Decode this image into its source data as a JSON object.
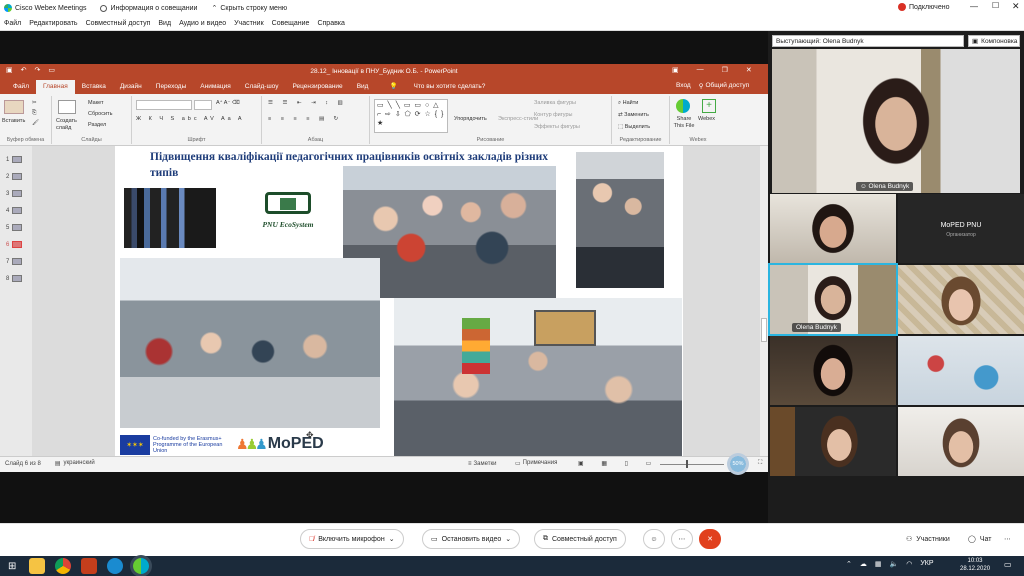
{
  "titlebar": {
    "app": "Cisco Webex Meetings",
    "tabs": [
      "Информация о совещании",
      "Скрыть строку меню"
    ],
    "connection": "Подключено",
    "colors": {
      "connected": "#d93025"
    }
  },
  "menubar": [
    "Файл",
    "Редактировать",
    "Совместный доступ",
    "Вид",
    "Аудио и видео",
    "Участник",
    "Совещание",
    "Справка"
  ],
  "ppt": {
    "title": "28.12_ Інновації в ПНУ_Будник О.Б.  -  PowerPoint",
    "tabs": [
      "Файл",
      "Главная",
      "Вставка",
      "Дизайн",
      "Переходы",
      "Анимация",
      "Слайд-шоу",
      "Рецензирование",
      "Вид"
    ],
    "tell_me": "Что вы хотите сделать?",
    "login": "Вход",
    "share": "Общий доступ",
    "groups": [
      "Буфер обмена",
      "Слайды",
      "Шрифт",
      "Абзац",
      "Рисование",
      "Редактирование",
      "Webex"
    ],
    "buttons": {
      "paste": "Вставить",
      "new_slide": "Создать слайд",
      "layout": "Макет",
      "reset": "Сбросить",
      "section": "Раздел",
      "arrange": "Упорядочить",
      "quick_styles": "Экспресс-стили",
      "fill": "Заливка фигуры",
      "outline": "Контур фигуры",
      "effects": "Эффекты фигуры",
      "find": "Найти",
      "replace": "Заменить",
      "select": "Выделить",
      "share_file": "Share This File",
      "webex": "Webex"
    },
    "colors": {
      "accent": "#b7472a"
    },
    "thumbnails": [
      "1",
      "2",
      "3",
      "4",
      "5",
      "6",
      "7",
      "8"
    ],
    "selected_slide": 6,
    "slide": {
      "title": "Підвищення кваліфікації педагогічних працівників освітніх закладів різних типів",
      "logo_text": "PNU EcoSystem",
      "eu_text": "Co-funded by the Erasmus+ Programme of the European Union",
      "moped_logo": "MoPED"
    },
    "status": {
      "slide_info": "Слайд 6 из 8",
      "language": "украинский",
      "notes": "Заметки",
      "comments": "Примечания",
      "zoom": "50%"
    }
  },
  "panel": {
    "speaker_label": "Выступающий: Olena Budnyk",
    "layout_btn": "Компоновка",
    "main_speaker_name": "Olena Budnyk",
    "tiles": [
      {
        "name": ""
      },
      {
        "name": "MoPED PNU",
        "role": "Организатор"
      },
      {
        "name": "Olena Budnyk"
      },
      {
        "name": ""
      },
      {
        "name": ""
      },
      {
        "name": ""
      },
      {
        "name": ""
      },
      {
        "name": ""
      }
    ]
  },
  "controls": {
    "mic": "Включить микрофон",
    "video": "Остановить видео",
    "share": "Совместный доступ",
    "participants": "Участники",
    "chat": "Чат",
    "colors": {
      "end": "#e1401d",
      "mic": "#d93025"
    }
  },
  "taskbar": {
    "time": "10:03",
    "date": "28.12.2020",
    "lang": "УКР"
  }
}
